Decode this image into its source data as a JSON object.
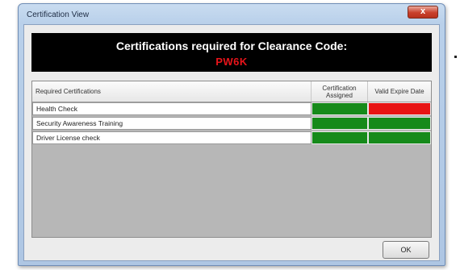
{
  "window": {
    "title": "Certification View",
    "close_label": "x"
  },
  "header": {
    "title": "Certifications required for Clearance Code:",
    "code": "PW6K",
    "code_color": "#e8141a"
  },
  "grid": {
    "columns": [
      "Required Certifications",
      "Certification Assigned",
      "Valid Expire Date"
    ],
    "rows": [
      {
        "name": "Health Check",
        "assigned": "green",
        "valid_expire": "red"
      },
      {
        "name": "Security Awareness Training",
        "assigned": "green",
        "valid_expire": "green"
      },
      {
        "name": "Driver License check",
        "assigned": "green",
        "valid_expire": "green"
      }
    ]
  },
  "status_colors": {
    "green": "#168a1a",
    "red": "#e81414"
  },
  "buttons": {
    "ok_label": "OK"
  }
}
